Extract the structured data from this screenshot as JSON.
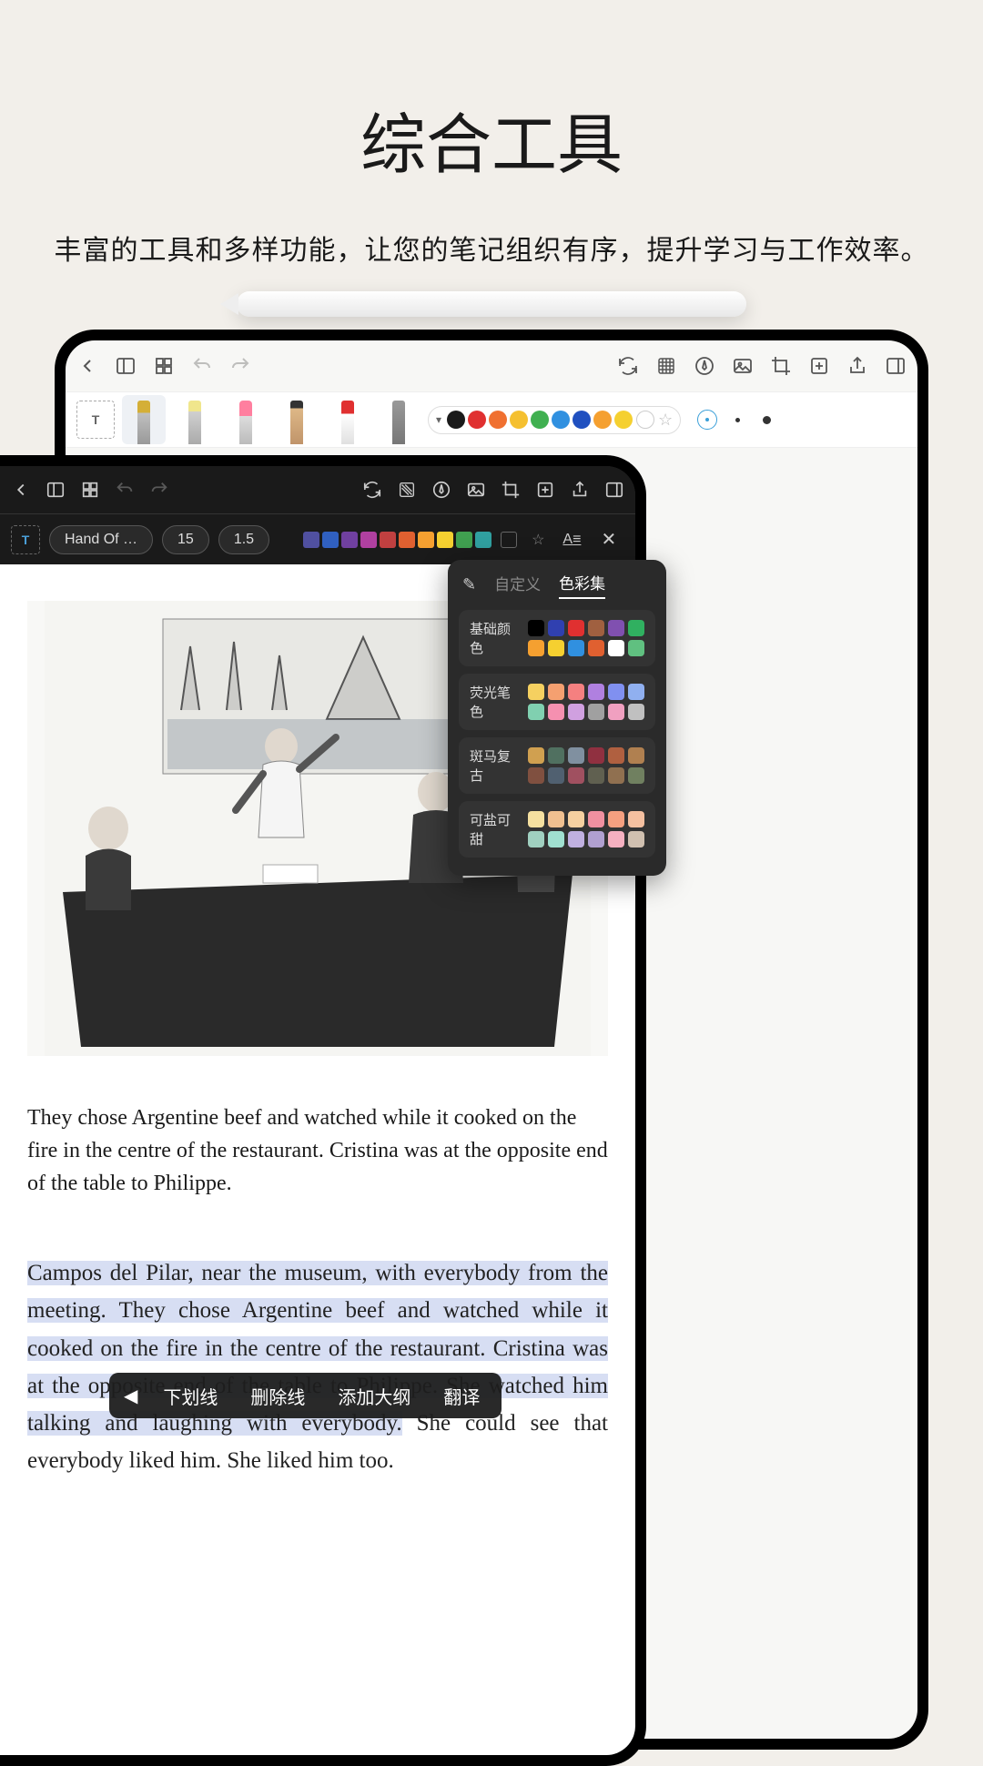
{
  "hero": {
    "title": "综合工具",
    "subtitle": "丰富的工具和多样功能，让您的笔记组织有序，提升学习与工作效率。"
  },
  "light_toolbar_colors": [
    "#1a1a1a",
    "#e03030",
    "#f07030",
    "#f5c030",
    "#40b050",
    "#3090e0",
    "#2050c0",
    "#f5a030",
    "#f5d030"
  ],
  "dark_settings": {
    "font": "Hand Of …",
    "size": "15",
    "line_height": "1.5",
    "text_style": "A",
    "colors": [
      "#1a1a1a",
      "#5050a0",
      "#3060c0",
      "#7040a0",
      "#b040a0",
      "#c04040",
      "#e06030",
      "#f5a030",
      "#f5d030",
      "#40a050",
      "#30a0a0"
    ]
  },
  "palette": {
    "tab_custom": "自定义",
    "tab_sets": "色彩集",
    "sections": [
      {
        "label": "基础颜色",
        "colors": [
          "#000000",
          "#3040b0",
          "#e03030",
          "#a06040",
          "#8050b0",
          "#30b060",
          "#f5a030",
          "#f5d030",
          "#3090e0",
          "#e06030",
          "#ffffff",
          "#60c080"
        ]
      },
      {
        "label": "荧光笔色",
        "colors": [
          "#f5d060",
          "#f5a070",
          "#f58080",
          "#b080e0",
          "#8090f0",
          "#90b0f0",
          "#80d0b0",
          "#f590b0",
          "#d0a0e0",
          "#a0a0a0",
          "#f0a0c0",
          "#c0c0c0"
        ]
      },
      {
        "label": "斑马复古",
        "colors": [
          "#d0a050",
          "#507060",
          "#8090a0",
          "#903040",
          "#b06040",
          "#b08050",
          "#805040",
          "#506070",
          "#a05060",
          "#606050",
          "#907050",
          "#708060"
        ]
      },
      {
        "label": "可盐可甜",
        "colors": [
          "#f5e0a0",
          "#f0c090",
          "#f5d0a0",
          "#f090a0",
          "#f5a080",
          "#f5c0a0",
          "#a0d0c0",
          "#a0e0d0",
          "#c0b0e0",
          "#b0a0d0",
          "#f5b0c0",
          "#d0c0b0"
        ]
      }
    ]
  },
  "context_menu": {
    "underline": "下划线",
    "strikethrough": "删除线",
    "add_outline": "添加大纲",
    "translate": "翻译"
  },
  "content": {
    "handwritten": "They chose Argentine beef and watched while it cooked on the fire in the centre of the restaurant. Cristina was at the opposite end of the table to Philippe.",
    "body_hl": "Campos del Pilar, near the museum, with everybody from the meeting. They chose Argentine beef and watched while it cooked on the fire in the centre of the restaurant. Cristina was at the opposite end of the table to Philippe. She watched him talking and laughing with everybody.",
    "body_tail": " She could see that everybody liked him. She liked him too."
  }
}
